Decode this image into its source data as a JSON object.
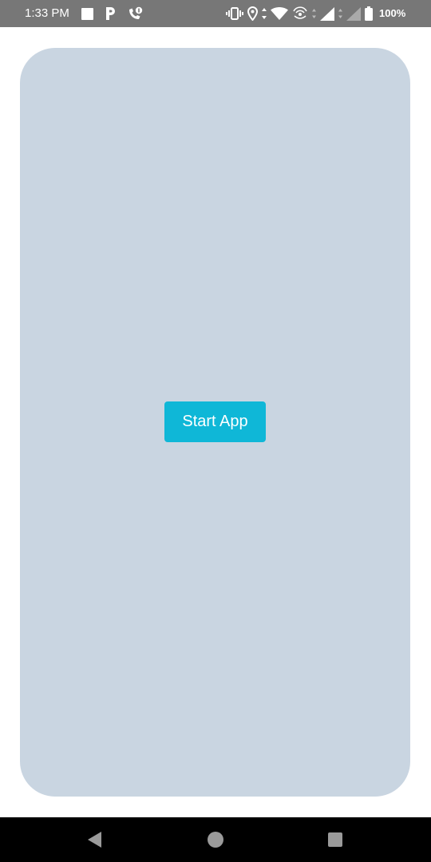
{
  "status_bar": {
    "time": "1:33 PM",
    "battery_text": "100%",
    "left_icons": [
      "square-notification-icon",
      "p-app-icon",
      "missed-call-icon"
    ],
    "right_icons": [
      "vibrate-icon",
      "location-icon",
      "wifi-icon",
      "hotspot-icon",
      "signal-icon",
      "signal-weak-icon",
      "battery-icon"
    ],
    "background": "#777777"
  },
  "main": {
    "card_color": "#c9d5e1",
    "start_button_label": "Start App",
    "start_button_color": "#0fb7d7"
  },
  "nav_bar": {
    "buttons": [
      "back-icon",
      "home-icon",
      "recents-icon"
    ],
    "background": "#000000"
  }
}
